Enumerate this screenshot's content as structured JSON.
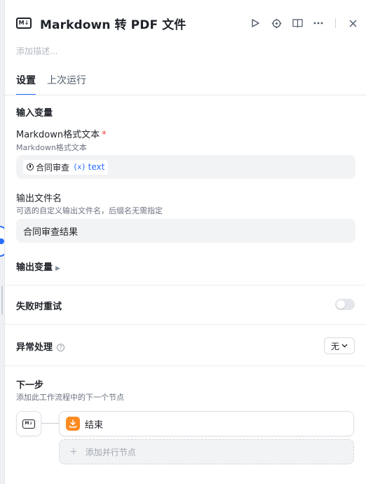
{
  "header": {
    "logo_text": "M↓",
    "title": "Markdown 转 PDF 文件",
    "icons": [
      "play-icon",
      "locate-icon",
      "book-icon",
      "more-icon",
      "close-icon"
    ]
  },
  "description_placeholder": "添加描述...",
  "tabs": [
    {
      "label": "设置",
      "active": true
    },
    {
      "label": "上次运行",
      "active": false
    }
  ],
  "input_section": {
    "title": "输入变量",
    "markdown_field": {
      "label": "Markdown格式文本",
      "required_mark": "*",
      "description": "Markdown格式文本",
      "chip_label": "合同审查",
      "var_symbol": "{x}",
      "var_name": "text"
    },
    "filename_field": {
      "label": "输出文件名",
      "description": "可选的自定义输出文件名，后缀名无需指定",
      "value": "合同审查结果"
    }
  },
  "output_section": {
    "title": "输出变量"
  },
  "retry": {
    "label": "失败时重试",
    "enabled": false
  },
  "exception": {
    "label": "异常处理",
    "value": "无"
  },
  "next_step": {
    "title": "下一步",
    "description": "添加此工作流程中的下一个节点",
    "node_logo": "M↓",
    "next_node_label": "结束",
    "add_parallel_label": "添加并行节点"
  },
  "colors": {
    "accent": "#296dff",
    "end_node": "#ff8a1f",
    "required": "#f53f3f"
  }
}
